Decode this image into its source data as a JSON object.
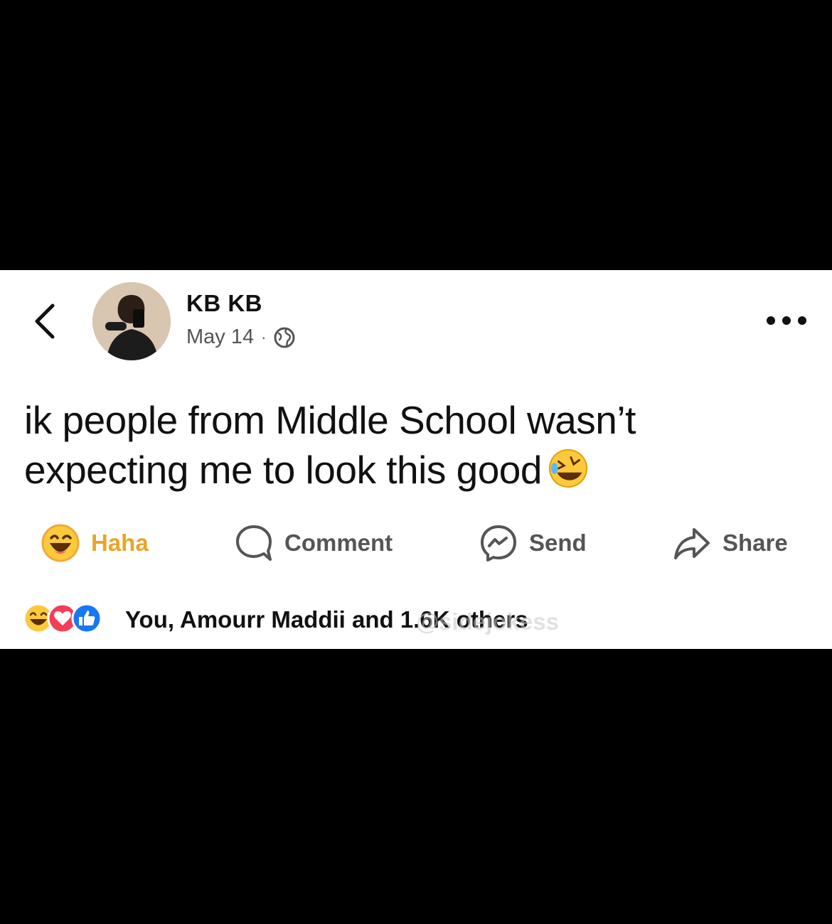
{
  "post": {
    "author_name": "KB KB",
    "date": "May 14",
    "separator": "·",
    "text": "ik people from Middle School wasn’t expecting me to look this good"
  },
  "actions": {
    "haha_label": "Haha",
    "comment_label": "Comment",
    "send_label": "Send",
    "share_label": "Share"
  },
  "reactions": {
    "summary": "You, Amourr Maddii and 1.6K others"
  },
  "watermark": "@sidejokess",
  "colors": {
    "haha": "#e8a527",
    "like": "#1877f2",
    "love": "#f33e58",
    "text": "#111111",
    "muted": "#555555"
  }
}
